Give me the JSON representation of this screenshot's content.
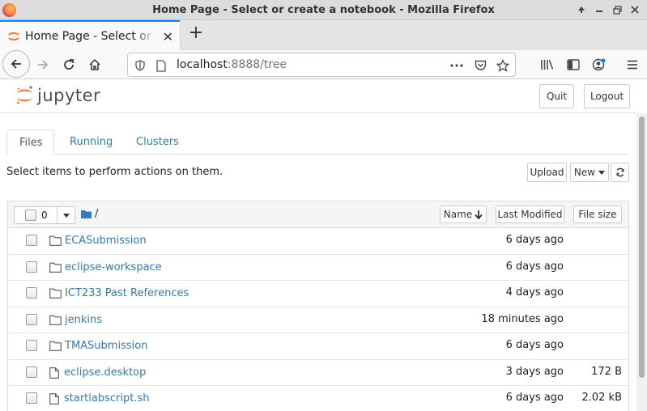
{
  "window": {
    "title": "Home Page - Select or create a notebook - Mozilla Firefox"
  },
  "browser": {
    "tab_title": "Home Page - Select or create a notebook",
    "url_host": "localhost",
    "url_rest": ":8888/tree"
  },
  "jupyter": {
    "logo_text": "jupyter",
    "quit_label": "Quit",
    "logout_label": "Logout",
    "tabs": [
      {
        "label": "Files",
        "active": true
      },
      {
        "label": "Running",
        "active": false
      },
      {
        "label": "Clusters",
        "active": false
      }
    ],
    "hint": "Select items to perform actions on them.",
    "upload_label": "Upload",
    "new_label": "New",
    "selected_count": "0",
    "breadcrumb": "/",
    "columns": {
      "name": "Name",
      "last_modified": "Last Modified",
      "file_size": "File size"
    },
    "items": [
      {
        "type": "folder",
        "name": "ECASubmission",
        "modified": "6 days ago",
        "size": ""
      },
      {
        "type": "folder",
        "name": "eclipse-workspace",
        "modified": "6 days ago",
        "size": ""
      },
      {
        "type": "folder",
        "name": "ICT233 Past References",
        "modified": "4 days ago",
        "size": ""
      },
      {
        "type": "folder",
        "name": "jenkins",
        "modified": "18 minutes ago",
        "size": ""
      },
      {
        "type": "folder",
        "name": "TMASubmission",
        "modified": "6 days ago",
        "size": ""
      },
      {
        "type": "file",
        "name": "eclipse.desktop",
        "modified": "3 days ago",
        "size": "172 B"
      },
      {
        "type": "file",
        "name": "startlabscript.sh",
        "modified": "6 days ago",
        "size": "2.02 kB"
      }
    ]
  },
  "colors": {
    "link": "#337ab7",
    "accent_tab": "#0a84ff",
    "jupyter_orange": "#f37726"
  }
}
